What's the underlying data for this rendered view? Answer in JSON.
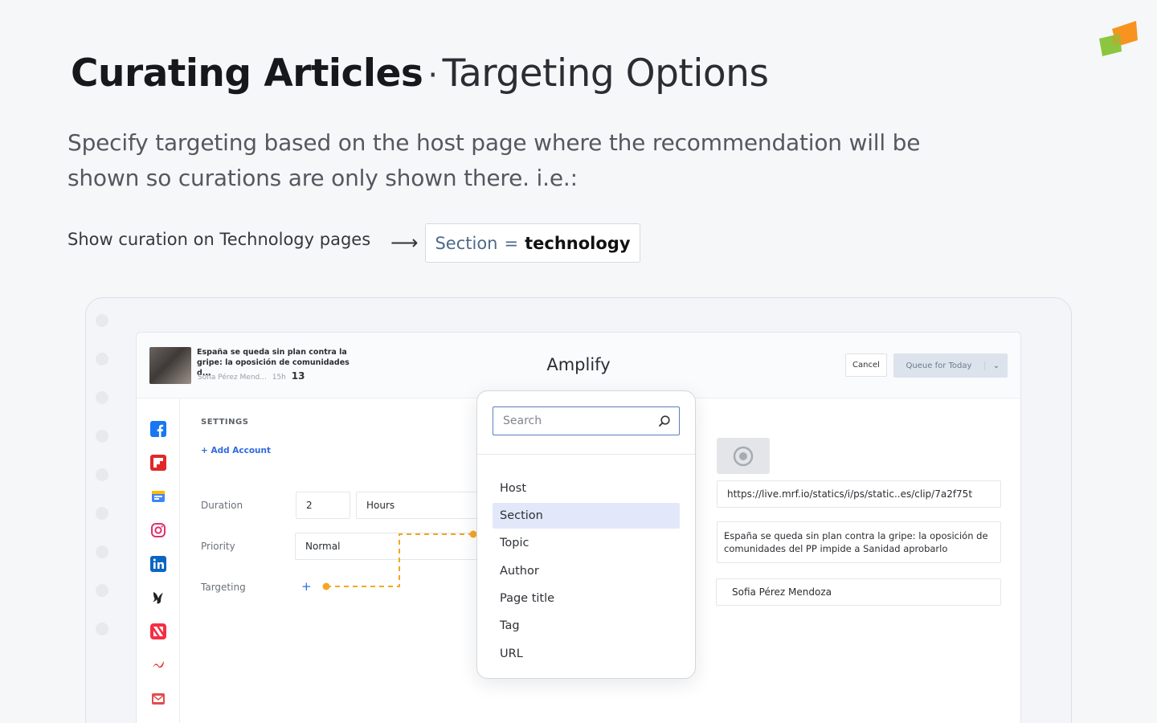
{
  "header": {
    "title_strong": "Curating Articles",
    "separator": "·",
    "title_light": "Targeting Options"
  },
  "description": "Specify targeting based on the host page where the recommendation will be shown so curations are only shown there. i.e.:",
  "example": {
    "label": "Show curation on Technology pages",
    "arrow": "⟶",
    "key": "Section",
    "operator": "=",
    "value": "technology"
  },
  "app": {
    "title": "Amplify",
    "article": {
      "title": "España se queda sin plan contra la gripe: la oposición de comunidades d...",
      "author": "Sofia Pérez Mend...",
      "age": "15h",
      "count": "13"
    },
    "cancel_label": "Cancel",
    "queue_label": "Queue for Today",
    "settings_title": "SETTINGS",
    "add_account_label": "+ Add Account",
    "duration_label": "Duration",
    "duration_value": "2",
    "duration_unit": "Hours",
    "priority_label": "Priority",
    "priority_value": "Normal",
    "targeting_label": "Targeting",
    "targeting_add": "+",
    "url_value": "https://live.mrf.io/statics/i/ps/static..es/clip/7a2f75t",
    "headline_value": "España se queda sin plan contra la gripe: la oposición de comunidades del PP impide a Sanidad aprobarlo",
    "author_value": "Sofia Pérez Mendoza"
  },
  "sidebar_icons": [
    "facebook-icon",
    "flipboard-icon",
    "google-news-icon",
    "instagram-icon",
    "linkedin-icon",
    "bird-icon",
    "apple-news-icon",
    "smartnews-icon",
    "email-icon"
  ],
  "popover": {
    "search_placeholder": "Search",
    "options": [
      "Host",
      "Section",
      "Topic",
      "Author",
      "Page title",
      "Tag",
      "URL"
    ],
    "selected": "Section"
  },
  "colors": {
    "accent": "#2f6bdc",
    "selected_bg": "#e2e8f9",
    "connector": "#f5a623",
    "logo_orange": "#f7931e",
    "logo_green": "#8cc63f"
  }
}
